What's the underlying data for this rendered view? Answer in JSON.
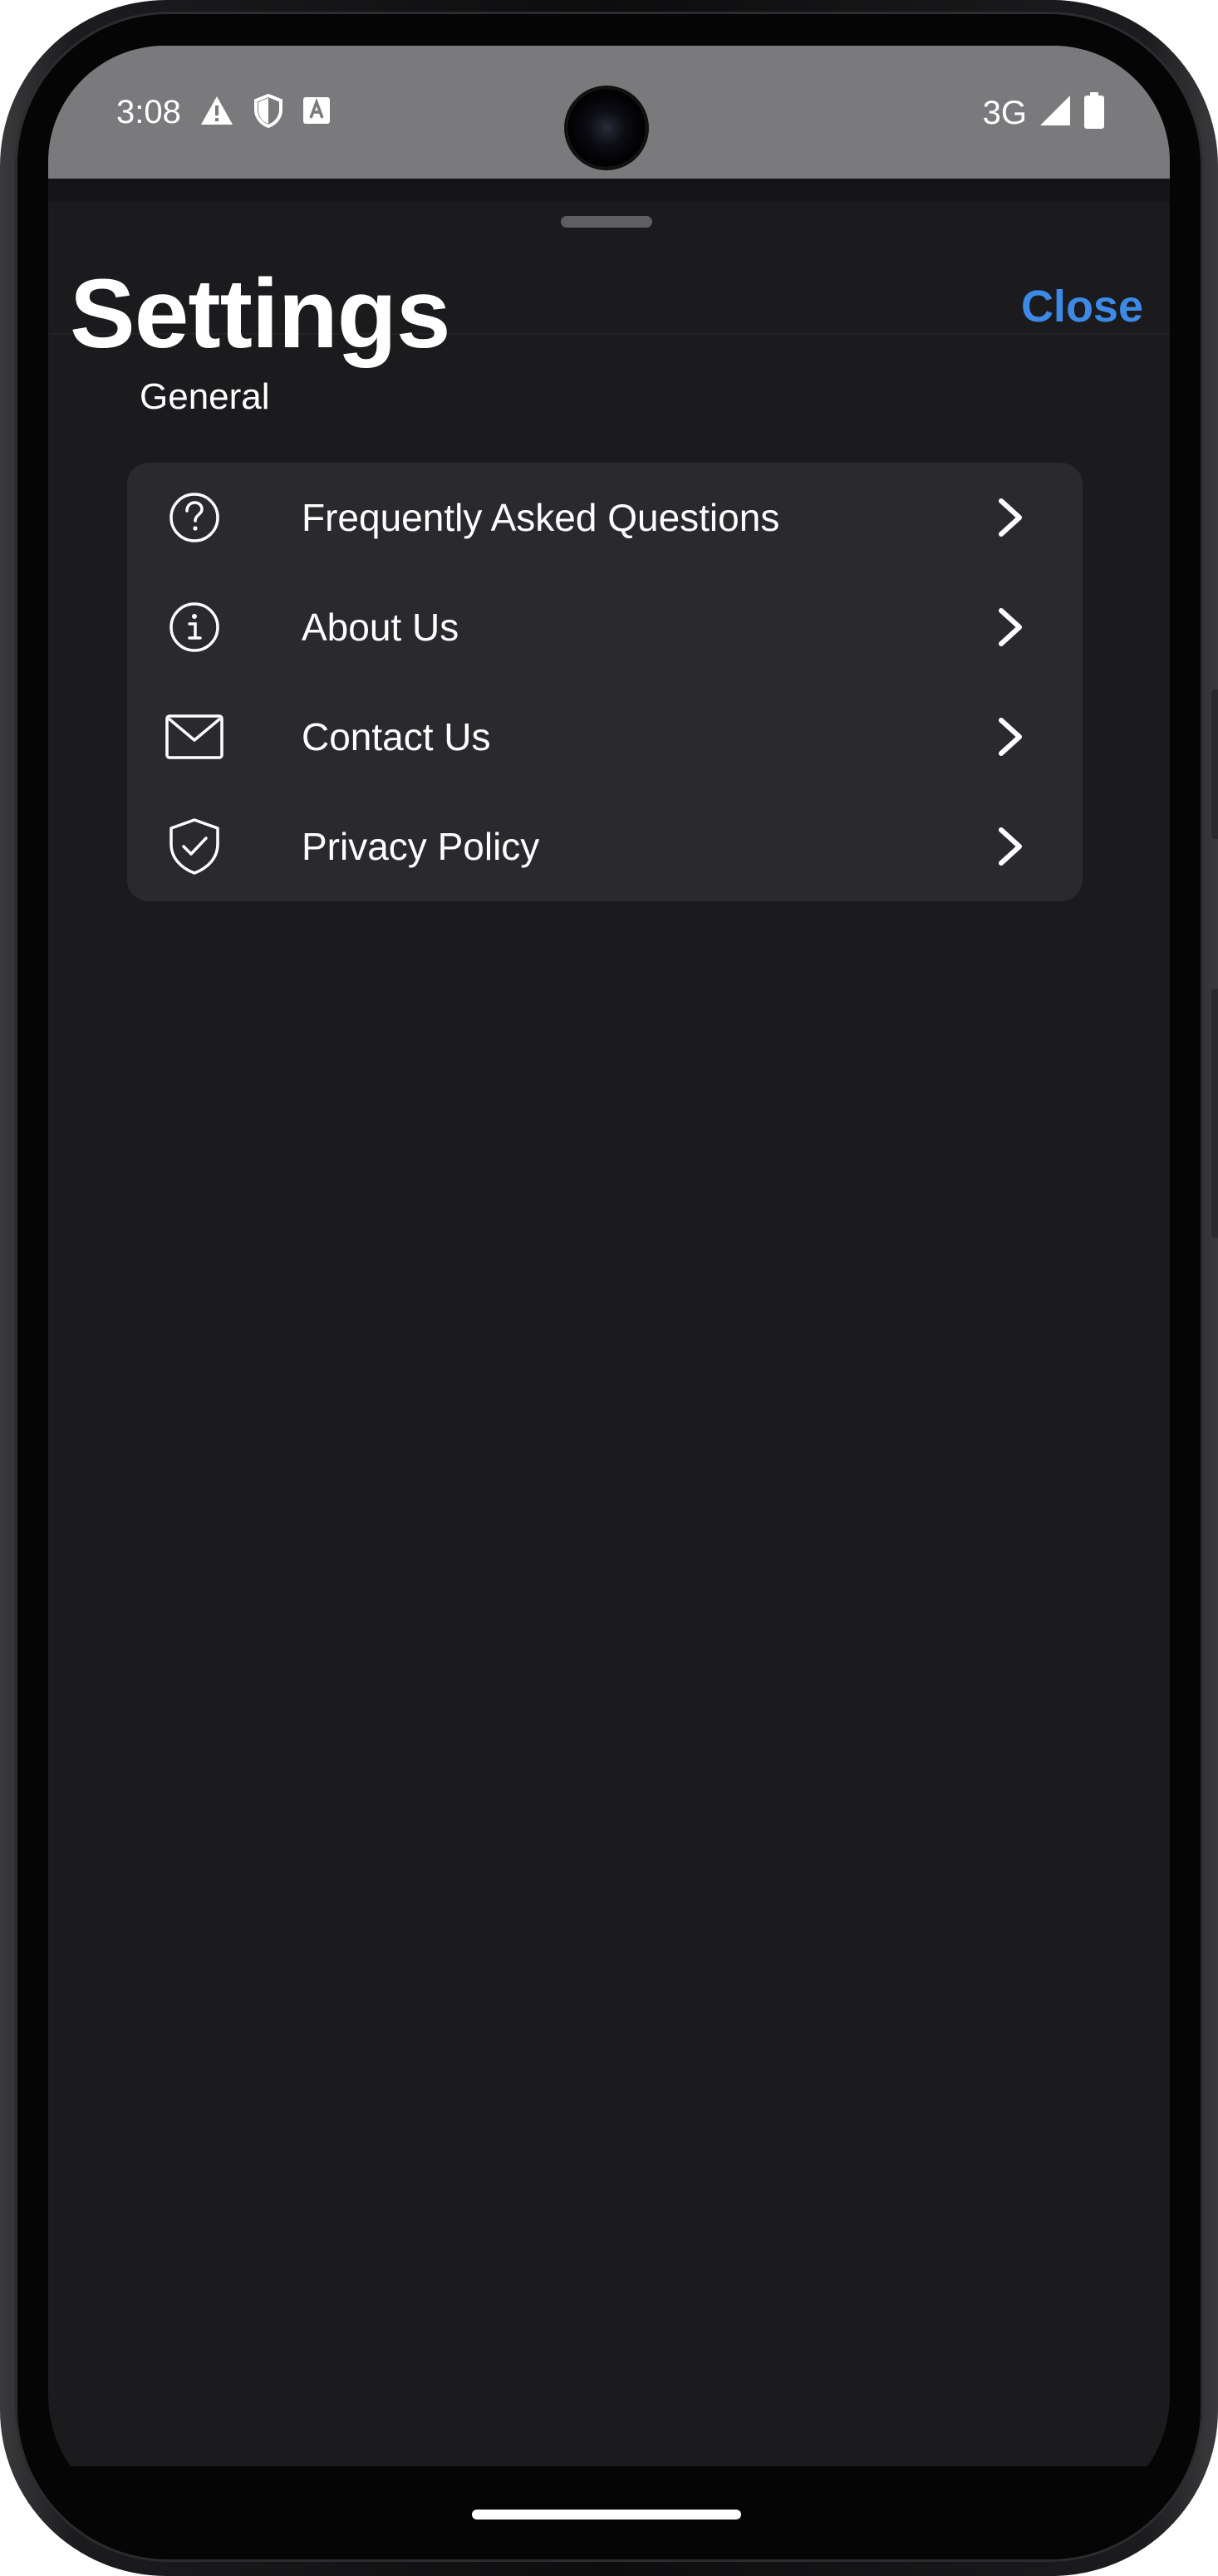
{
  "status_bar": {
    "time": "3:08",
    "network": "3G",
    "icons": [
      "warning-icon",
      "shield-icon",
      "text-a-icon",
      "signal-icon",
      "battery-icon"
    ]
  },
  "header": {
    "title": "Settings",
    "close_label": "Close"
  },
  "section": {
    "label": "General",
    "items": [
      {
        "label": "Frequently Asked Questions",
        "icon": "question-circle-icon"
      },
      {
        "label": "About Us",
        "icon": "info-circle-icon"
      },
      {
        "label": "Contact Us",
        "icon": "envelope-icon"
      },
      {
        "label": "Privacy Policy",
        "icon": "shield-check-icon"
      }
    ]
  },
  "colors": {
    "background": "#1b1a1d",
    "card": "#2a292d",
    "accent": "#3d8ae6",
    "status_bar": "#7a797b"
  }
}
